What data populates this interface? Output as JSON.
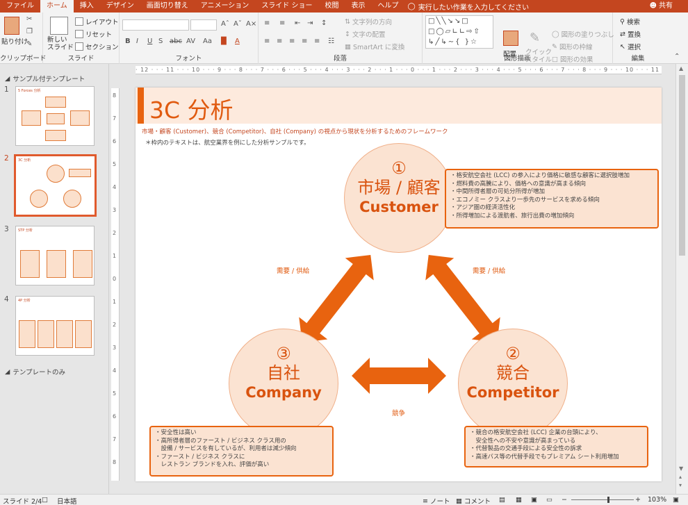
{
  "tabs": [
    "ファイル",
    "ホーム",
    "挿入",
    "デザイン",
    "画面切り替え",
    "アニメーション",
    "スライド ショー",
    "校閲",
    "表示",
    "ヘルプ"
  ],
  "active_tab": "ホーム",
  "tell_me": "実行したい作業を入力してください",
  "share": "共有",
  "ribbon": {
    "clipboard": {
      "paste": "貼り付け",
      "label": "クリップボード"
    },
    "slides": {
      "new_slide": "新しい\nスライド",
      "layout": "レイアウト",
      "reset": "リセット",
      "section": "セクション",
      "label": "スライド"
    },
    "font": {
      "label": "フォント"
    },
    "paragraph": {
      "text_direction": "文字列の方向",
      "align_text": "文字の配置",
      "smartart": "SmartArt に変換",
      "label": "段落"
    },
    "drawing": {
      "arrange": "配置",
      "quick_styles": "クイック\nスタイル",
      "fill": "図形の塗りつぶし",
      "outline": "図形の枠線",
      "effects": "図形の効果",
      "label": "図形描画"
    },
    "editing": {
      "find": "検索",
      "replace": "置換",
      "select": "選択",
      "label": "編集"
    }
  },
  "left_panel": {
    "section1": "サンプル付テンプレート",
    "section2": "テンプレートのみ",
    "thumbs": [
      {
        "num": "1",
        "title": "5 Forces 分析"
      },
      {
        "num": "2",
        "title": "3C 分析"
      },
      {
        "num": "3",
        "title": "STP 分析"
      },
      {
        "num": "4",
        "title": "4P 分析"
      }
    ]
  },
  "ruler": {
    "h": "· 12 · · · 11 · · · 10 · · · 9 · · · 8 · · · 7 · · · 6 · · · 5 · · · 4 · · · 3 · · · 2 · · · 1 · · · 0 · · · 1 · · · 2 · · · 3 · · · 4 · · · 5 · · · 6 · · · 7 · · · 8 · · · 9 · · · 10 · · · 11 · · · 12 ·",
    "v": [
      "8",
      "7",
      "6",
      "5",
      "4",
      "3",
      "2",
      "1",
      "0",
      "1",
      "2",
      "3",
      "4",
      "5",
      "6",
      "7",
      "8"
    ]
  },
  "slide": {
    "title": "3C 分析",
    "subtitle": "市場・顧客 (Customer)、競合 (Competitor)、自社 (Company) の視点から現状を分析するためのフレームワーク",
    "note": "＊枠内のテキストは、航空業界を例にした分析サンプルです。",
    "customer": {
      "num": "①",
      "jp": "市場 / 顧客",
      "en": "Customer"
    },
    "competitor": {
      "num": "②",
      "jp": "競合",
      "en": "Competitor"
    },
    "company": {
      "num": "③",
      "jp": "自社",
      "en": "Company"
    },
    "label_left": "需要 / 供給",
    "label_right": "需要 / 供給",
    "label_bottom": "競争",
    "customer_box": [
      "・格安航空会社 (LCC) の参入により価格に敏感な顧客に選択肢増加",
      "・燃料費の高騰により、価格への意識が高まる傾向",
      "・中間所得者層の可処分所得が増加",
      "・エコノミー クラスより一歩先のサービスを求める傾向",
      "・アジア圏の経済活性化",
      "・所得増加による渡航者、旅行出費の増加傾向"
    ],
    "company_box": [
      "・安全性は高い",
      "・高所得者層のファースト / ビジネス クラス用の",
      "　設備 / サービスを有しているが、利用者は減少傾向",
      "・ファースト / ビジネス クラスに",
      "　レストラン ブランドを入れ、評価が高い"
    ],
    "competitor_box": [
      "・競合の格安航空会社 (LCC) 企業の台頭により、",
      "　安全性への不安や意識が高まっている",
      "・代替製品の交通手段による安全性の訴求",
      "・高速バス等の代替手段でもプレミアム シート利用増加"
    ]
  },
  "status": {
    "slide": "スライド 2/4",
    "lang": "日本語",
    "notes": "ノート",
    "comments": "コメント",
    "zoom": "103%"
  },
  "colors": {
    "accent": "#c4461f",
    "orange": "#e8630f",
    "fill": "#fbe3d2"
  }
}
